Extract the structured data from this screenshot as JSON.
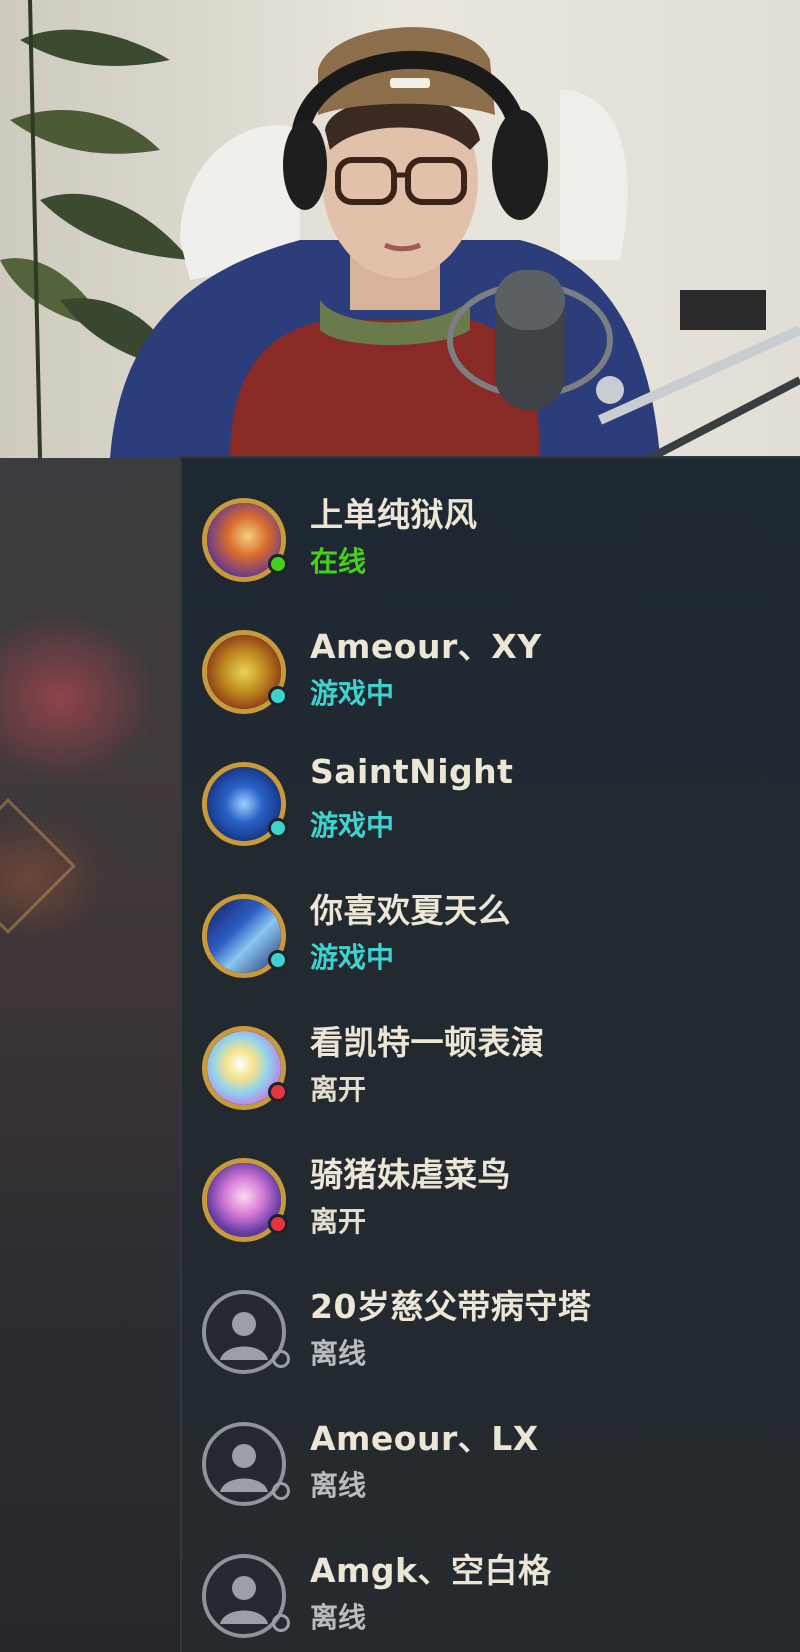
{
  "friends": [
    {
      "name": "上单纯狱风",
      "status": "在线",
      "state": "online"
    },
    {
      "name": "Ameour、XY",
      "status": "游戏中",
      "state": "in-game"
    },
    {
      "name": "SaintNight",
      "status": "游戏中",
      "state": "in-game"
    },
    {
      "name": "你喜欢夏天么",
      "status": "游戏中",
      "state": "in-game"
    },
    {
      "name": "看凯特一顿表演",
      "status": "离开",
      "state": "away"
    },
    {
      "name": "骑猪妹虐菜鸟",
      "status": "离开",
      "state": "away"
    },
    {
      "name": "20岁慈父带病守塔",
      "status": "离线",
      "state": "offline"
    },
    {
      "name": "Ameour、LX",
      "status": "离线",
      "state": "offline"
    },
    {
      "name": "Amgk、空白格",
      "status": "离线",
      "state": "offline"
    }
  ],
  "status_colors": {
    "online": "#45d11a",
    "in-game": "#3fd3cf",
    "away": "#e8343d",
    "offline": "#9aa0a5"
  },
  "icons": {
    "offline_avatar": "default-user-icon"
  }
}
